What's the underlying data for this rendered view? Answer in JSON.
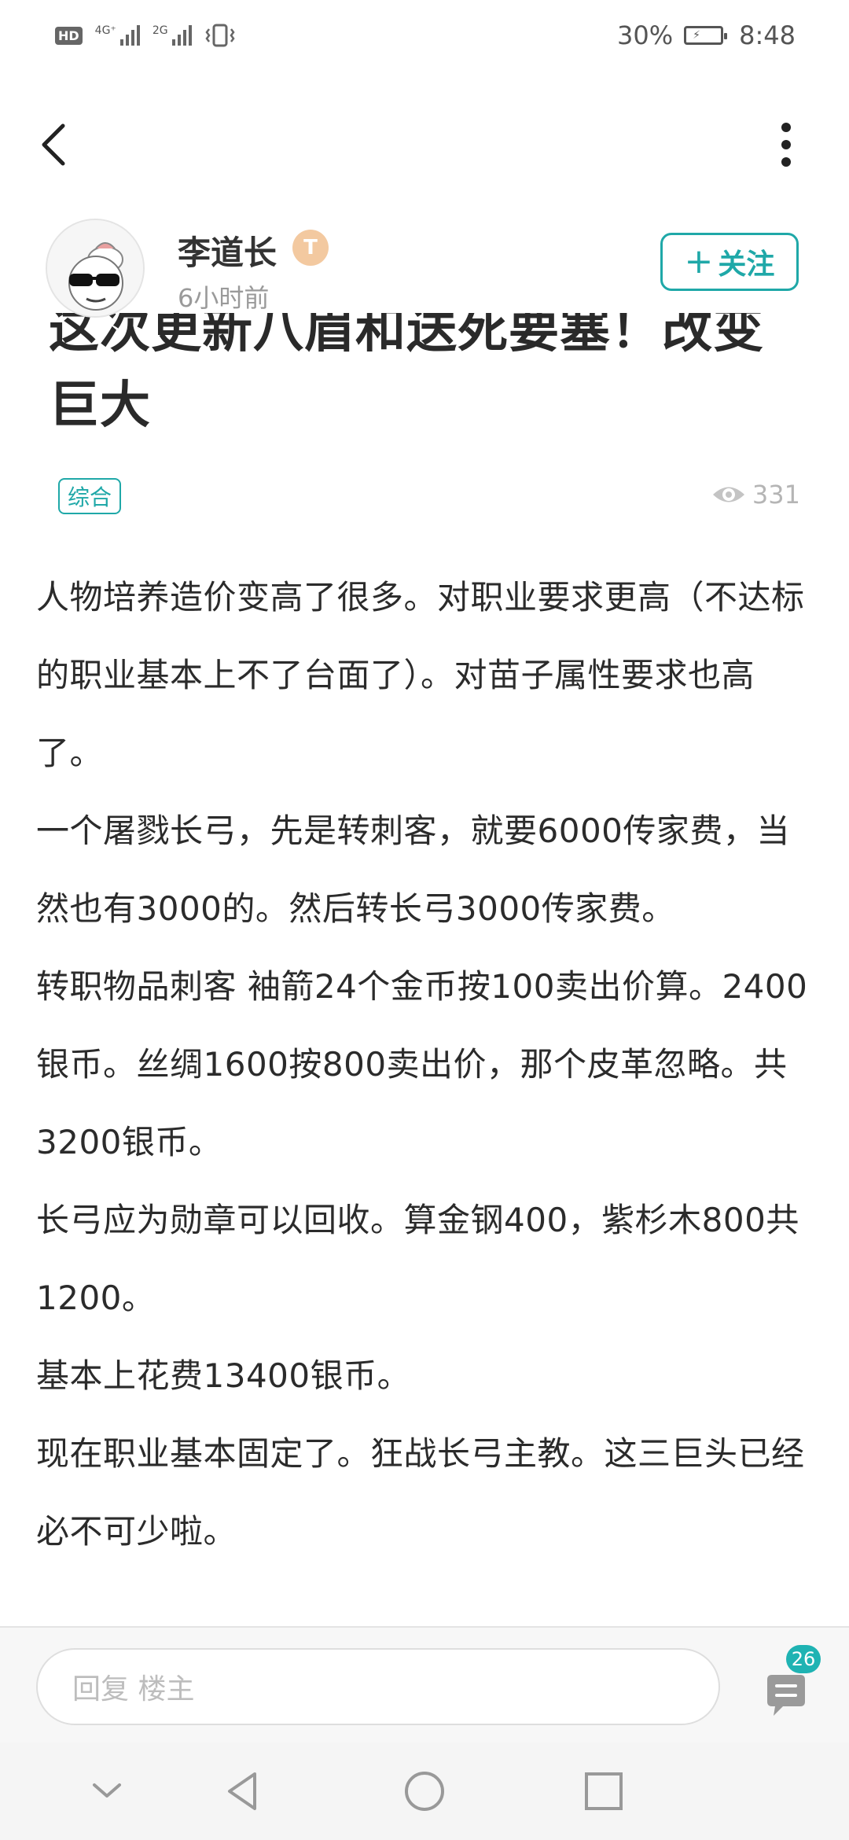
{
  "status_bar": {
    "hd": "HD",
    "sim1": "4G⁺",
    "sim2": "2G",
    "battery_percent": "30%",
    "time": "8:48"
  },
  "icons": {
    "back": "back-arrow-icon",
    "more": "more-vertical-icon",
    "views": "eye-icon",
    "comments": "comment-bubble-icon"
  },
  "author": {
    "name": "李道长",
    "level_badge": "T",
    "time": "6小时前",
    "follow_label": "关注"
  },
  "post": {
    "title": "这次更新八眉和送死要塞！改变巨大",
    "category": "综合",
    "views": "331",
    "paragraphs": [
      "人物培养造价变高了很多。对职业要求更高（不达标的职业基本上不了台面了）。对苗子属性要求也高了。",
      "一个屠戮长弓，先是转刺客，就要6000传家费，当然也有3000的。然后转长弓3000传家费。",
      "转职物品刺客 袖箭24个金币按100卖出价算。2400银币。丝绸1600按800卖出价，那个皮革忽略。共3200银币。",
      "长弓应为勋章可以回收。算金钢400，紫杉木800共1200。",
      "基本上花费13400银币。",
      "现在职业基本固定了。狂战长弓主教。这三巨头已经必不可少啦。"
    ]
  },
  "reply": {
    "placeholder": "回复 楼主",
    "comment_count": "26"
  },
  "colors": {
    "accent": "#1fa8a8",
    "badge": "#1fb3b3",
    "level_badge": "#f3c9a0"
  }
}
